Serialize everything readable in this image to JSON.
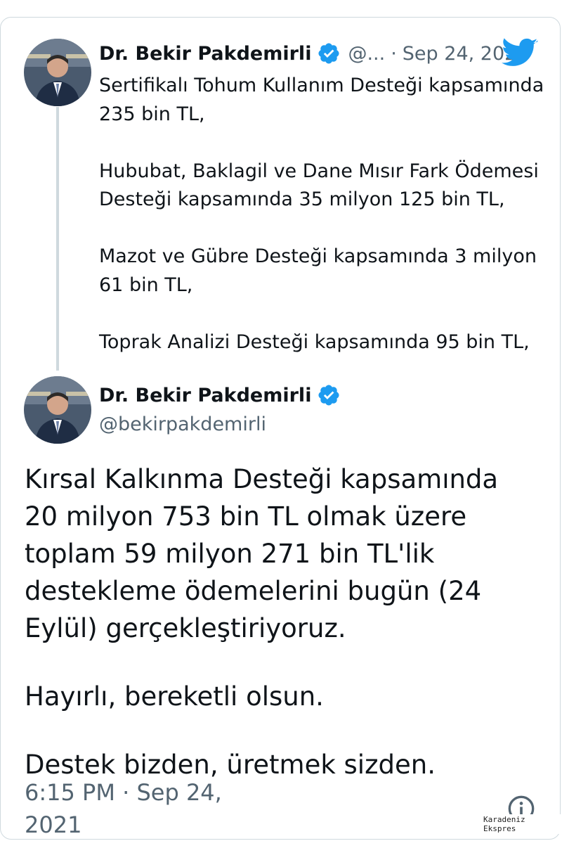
{
  "reply_tweet": {
    "author_name": "Dr. Bekir Pakdemirli",
    "handle_truncated": "@...",
    "separator": "·",
    "date": "Sep 24, 2021",
    "paragraphs": [
      "Sertifikalı Tohum Kullanım Desteği kapsamında 235 bin TL,",
      "Hububat, Baklagil ve Dane Mısır Fark Ödemesi Desteği kapsamında 35 milyon 125 bin TL,",
      "Mazot ve Gübre Desteği kapsamında 3 milyon 61 bin TL,",
      "Toprak Analizi Desteği kapsamında 95 bin TL,"
    ]
  },
  "main_tweet": {
    "author_name": "Dr. Bekir Pakdemirli",
    "handle": "@bekirpakdemirli",
    "paragraphs": [
      "Kırsal Kalkınma Desteği kapsamında 20 milyon 753 bin TL olmak üzere toplam 59 milyon 271 bin TL'lik destekleme ödemelerini bugün (24 Eylül) gerçekleştiriyoruz.",
      "Hayırlı, bereketli olsun.",
      "Destek bizden, üretmek sizden."
    ],
    "timestamp": "6:15 PM · Sep 24, 2021"
  },
  "icons": {
    "verified": "verified-badge-icon",
    "logo": "twitter-bird-icon",
    "info": "info-icon"
  },
  "colors": {
    "twitter_blue": "#1d9bf0",
    "text": "#0f1419",
    "muted": "#536471",
    "border": "#cfd9de"
  },
  "watermark": "Karadeniz Ekspres"
}
